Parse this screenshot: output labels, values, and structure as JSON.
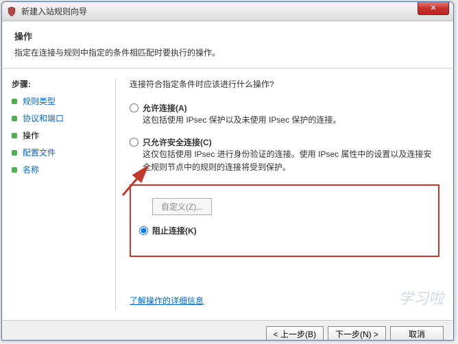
{
  "window": {
    "title": "新建入站规则向导"
  },
  "header": {
    "title": "操作",
    "subtitle": "指定在连接与规则中指定的条件相匹配时要执行的操作。"
  },
  "sidebar": {
    "title": "步骤:",
    "items": [
      {
        "label": "规则类型"
      },
      {
        "label": "协议和端口"
      },
      {
        "label": "操作"
      },
      {
        "label": "配置文件"
      },
      {
        "label": "名称"
      }
    ]
  },
  "content": {
    "question": "连接符合指定条件时应该进行什么操作?",
    "options": [
      {
        "label": "允许连接(A)",
        "desc": "这包括使用 IPsec 保护以及未使用 IPsec 保护的连接。"
      },
      {
        "label": "只允许安全连接(C)",
        "desc": "这仅包括使用 IPsec 进行身份验证的连接。使用 IPsec 属性中的设置以及连接安全规则节点中的规则的连接将受到保护。"
      },
      {
        "label": "阻止连接(K)",
        "desc": ""
      }
    ],
    "custom_btn": "自定义(Z)...",
    "learn_more": "了解操作的详细信息"
  },
  "footer": {
    "back": "< 上一步(B)",
    "next": "下一步(N) >",
    "cancel": "取消"
  },
  "watermark": "学习啦"
}
